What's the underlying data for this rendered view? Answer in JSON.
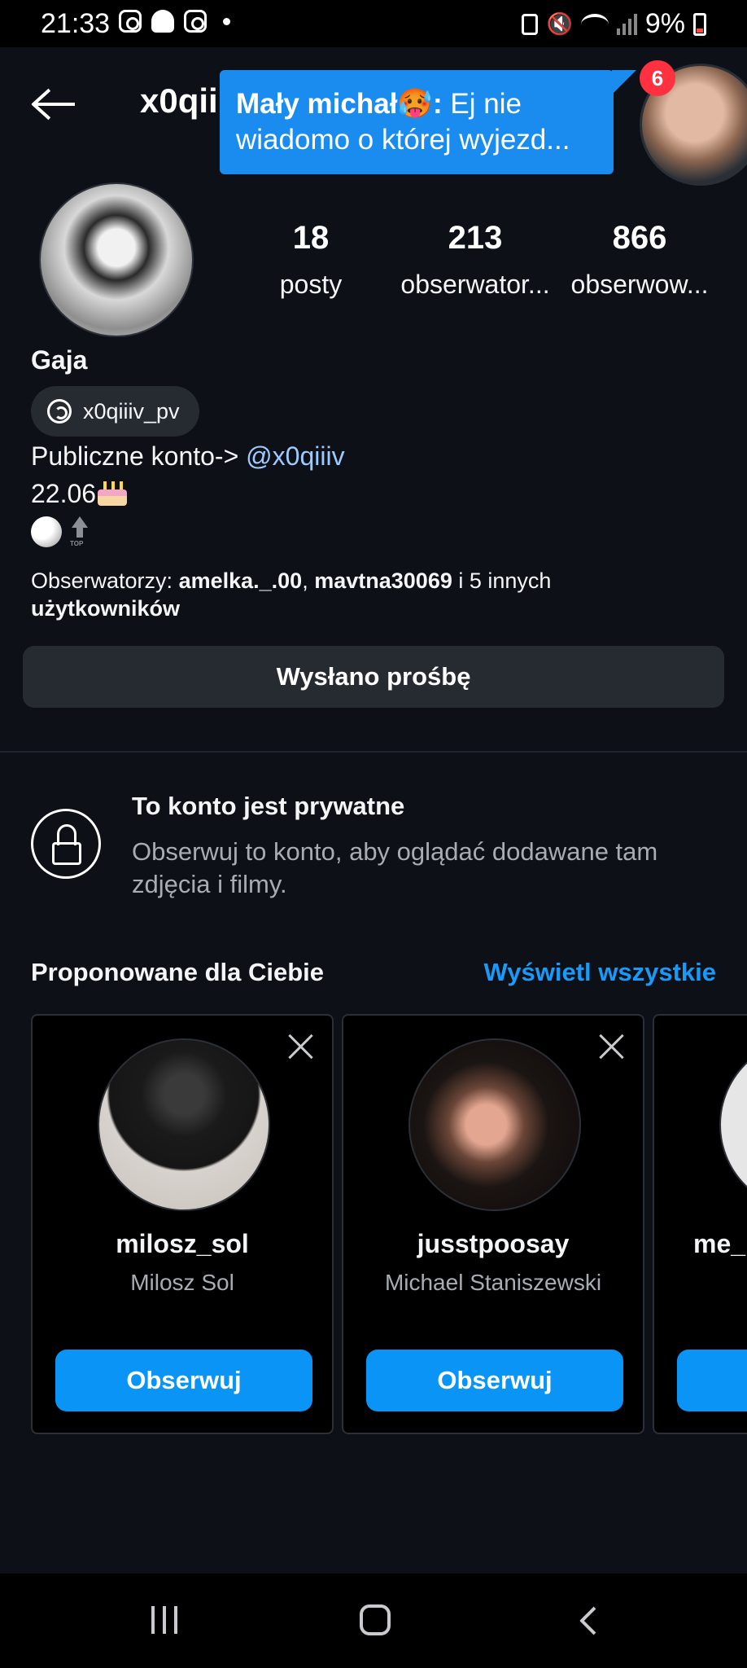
{
  "status_bar": {
    "time": "21:33",
    "battery": "9%"
  },
  "header": {
    "username": "x0qii"
  },
  "notification": {
    "sender": "Mały michał🥵:",
    "message_part1": "Ej nie",
    "message_part2": "wiadomo o której wyjezd...",
    "badge_count": "6"
  },
  "profile": {
    "stats": [
      {
        "value": "18",
        "label": "posty"
      },
      {
        "value": "213",
        "label": "obserwator..."
      },
      {
        "value": "866",
        "label": "obserwow..."
      }
    ],
    "display_name": "Gaja",
    "threads_handle": "x0qiiiv_pv",
    "bio_prefix": "Publiczne konto->",
    "bio_mention": "@x0qiiiv",
    "bio_date": "22.06",
    "top_badge": "TOP",
    "followed_by_prefix": "Obserwatorzy:",
    "followed_by_user1": "amelka._.00",
    "followed_by_sep": ",",
    "followed_by_user2": "mavtna30069",
    "followed_by_suffix": "i 5 innych",
    "followed_by_suffix2": "użytkowników",
    "request_button": "Wysłano prośbę"
  },
  "private_notice": {
    "title": "To konto jest prywatne",
    "description": "Obserwuj to konto, aby oglądać dodawane tam zdjęcia i filmy."
  },
  "suggestions": {
    "title": "Proponowane dla Ciebie",
    "see_all": "Wyświetl wszystkie",
    "cards": [
      {
        "username": "milosz_sol",
        "name": "Milosz Sol",
        "button": "Obserwuj"
      },
      {
        "username": "jusstpoosay",
        "name": "Michael Staniszewski",
        "button": "Obserwuj"
      },
      {
        "username": "me_l"
      }
    ]
  },
  "icons": {
    "back": "arrow-left-icon",
    "threads": "threads-icon",
    "lock": "lock-icon",
    "close": "close-icon",
    "cake": "birthday-cake-icon",
    "volleyball": "volleyball-icon",
    "top": "top-arrow-icon"
  },
  "colors": {
    "background": "#0d1016",
    "accent": "#0a95f6",
    "link": "#1a9af8",
    "notification": "#1a8cf0",
    "badge": "#ff3040"
  }
}
